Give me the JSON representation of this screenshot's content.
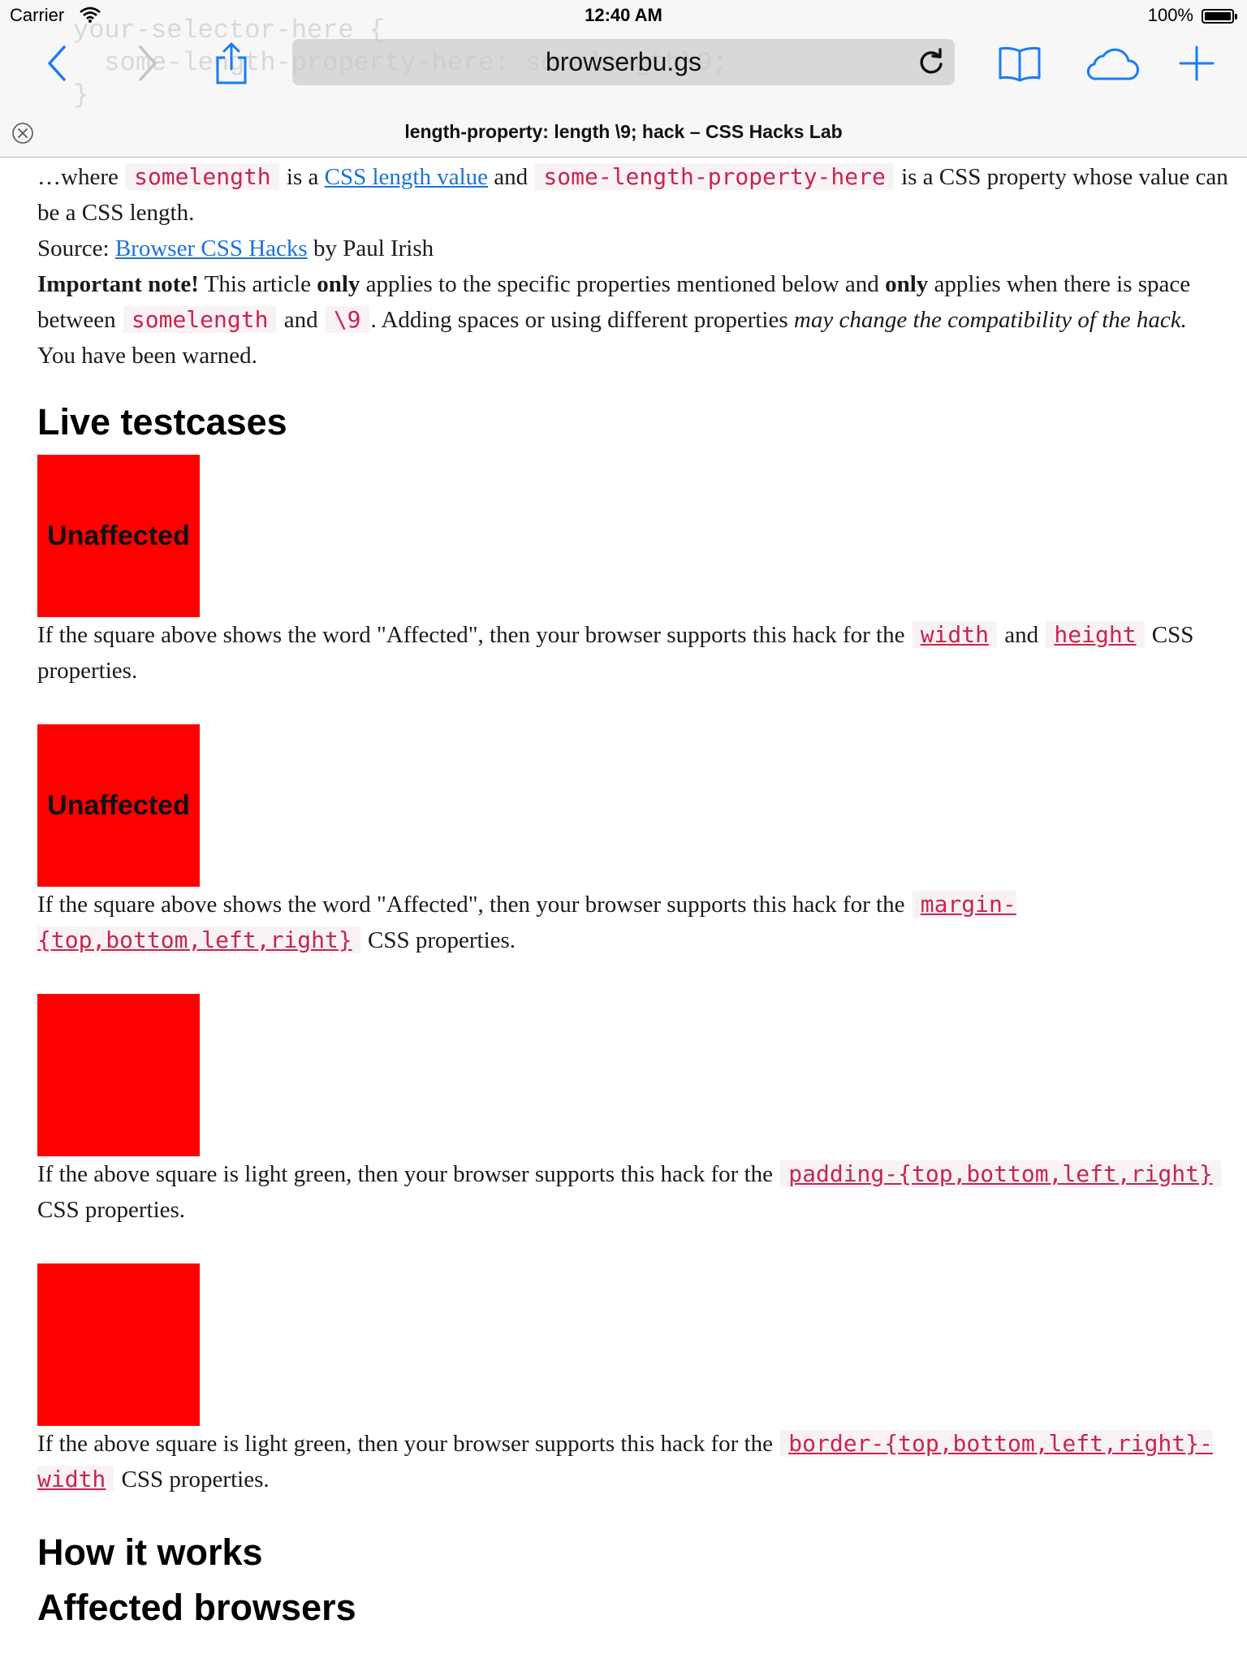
{
  "status_bar": {
    "carrier": "Carrier",
    "time": "12:40 AM",
    "battery": "100%"
  },
  "toolbar": {
    "url": "browserbu.gs",
    "ghost_text": "your-selector-here {\n  some-length-property-here: somelength\\9;\n}"
  },
  "tab": {
    "title": "length-property: length \\9; hack – CSS Hacks Lab"
  },
  "article": {
    "intro": {
      "t1": "…where",
      "code1": "somelength",
      "t2": "is a",
      "link": "CSS length value",
      "t3": "and",
      "code2": "some-length-property-here",
      "t4": "is a CSS property whose value can be a CSS length."
    },
    "source": {
      "label": "Source:",
      "link": "Browser CSS Hacks",
      "by": "by Paul Irish"
    },
    "note": {
      "bold1": "Important note!",
      "t1": "This article",
      "bold2": "only",
      "t2": "applies to the specific properties mentioned below and",
      "bold3": "only",
      "t3": "applies when there is space between",
      "code1": "somelength",
      "t4": "and",
      "code2": "\\9",
      "t5": ". Adding spaces or using different properties",
      "em": "may change the compatibility of the hack.",
      "warned": "You have been warned."
    },
    "live_heading": "Live testcases",
    "cases": [
      {
        "square_label": "Unaffected",
        "pre": "If the square above shows the word \"Affected\", then your browser supports this hack for the",
        "code1": "width",
        "mid": "and",
        "code2": "height",
        "post": "CSS properties."
      },
      {
        "square_label": "Unaffected",
        "pre": "If the square above shows the word \"Affected\", then your browser supports this hack for the",
        "code1": "margin-{top,bottom,left,right}",
        "post": "CSS properties."
      },
      {
        "square_label": "",
        "pre": "If the above square is light green, then your browser supports this hack for the",
        "code1": "padding-{top,bottom,left,right}",
        "post": "CSS properties."
      },
      {
        "square_label": "",
        "pre": "If the above square is light green, then your browser supports this hack for the",
        "code1": "border-{top,bottom,left,right}-width",
        "post": "CSS properties."
      }
    ],
    "how_heading": "How it works",
    "next_heading": "Affected browsers"
  },
  "colors": {
    "square": "#ff0000",
    "link": "#1a73d8",
    "code_text": "#c7254e",
    "code_bg": "#f9f2f4",
    "ios_blue": "#1a7cf5"
  },
  "icons": [
    "wifi-icon",
    "battery-icon",
    "back-icon",
    "forward-icon",
    "share-icon",
    "reload-icon",
    "bookmarks-icon",
    "icloud-tabs-icon",
    "new-tab-icon",
    "close-tab-icon"
  ]
}
